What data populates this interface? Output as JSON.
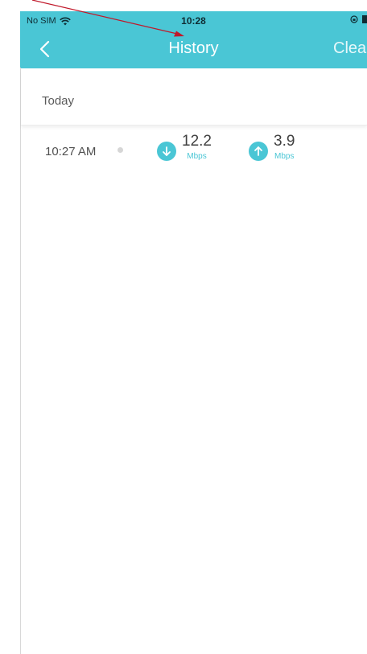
{
  "status_bar": {
    "carrier": "No SIM",
    "time": "10:28"
  },
  "nav": {
    "title": "History",
    "back_icon": "chevron-left-icon",
    "clear_label": "Clear"
  },
  "section": {
    "label": "Today"
  },
  "history": [
    {
      "time": "10:27 AM",
      "download": {
        "value": "12.2",
        "unit": "Mbps",
        "icon": "arrow-down-icon"
      },
      "upload": {
        "value": "3.9",
        "unit": "Mbps",
        "icon": "arrow-up-icon"
      }
    }
  ],
  "colors": {
    "accent": "#4ac6d5",
    "annotation": "#c0182a"
  }
}
